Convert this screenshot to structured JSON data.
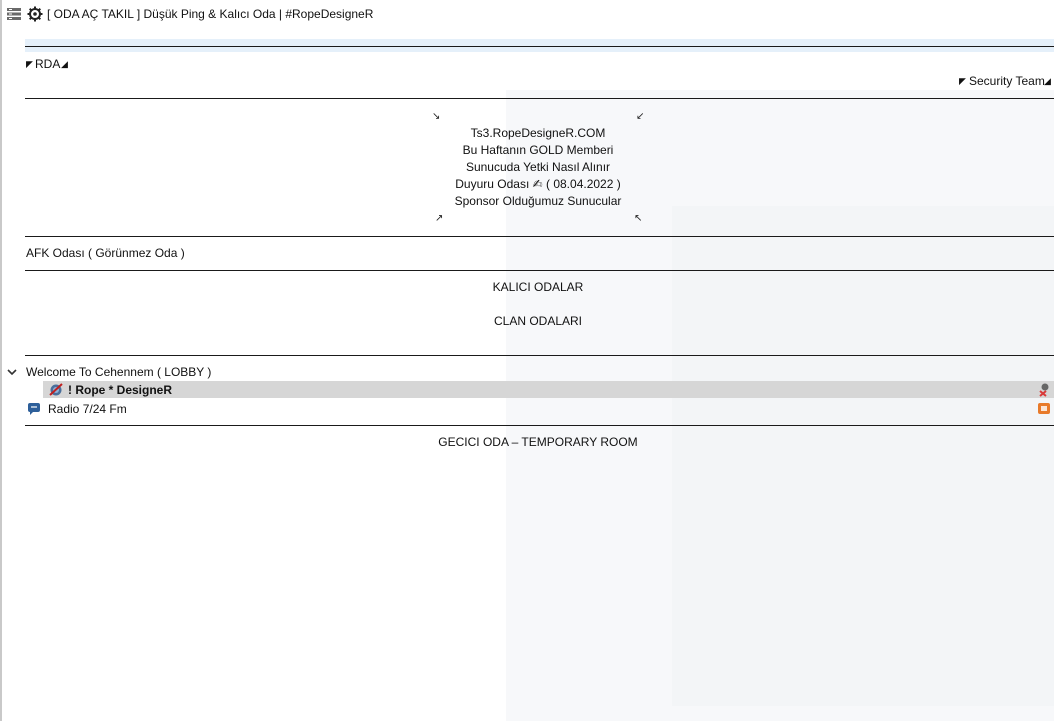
{
  "server": {
    "title": "[ ODA AÇ TAKIL ] Düşük Ping & Kalıcı Oda | #RopeDesigneR"
  },
  "channels": {
    "rda": "RDA",
    "security_team": "Security Team",
    "info_lines": [
      "Ts3.RopeDesigneR.COM",
      "Bu Haftanın GOLD Memberi",
      "Sunucuda Yetki Nasıl Alınır",
      "Duyuru Odası ✍ ( 08.04.2022 )",
      "Sponsor Olduğumuz Sunucular"
    ],
    "afk": "AFK Odası ( Görünmez Oda )",
    "kalici": "KALICI ODALAR",
    "clan": "CLAN ODALARI",
    "lobby": "Welcome To Cehennem ( LOBBY )",
    "temporary": "GECICI ODA – TEMPORARY ROOM"
  },
  "lobby_clients": [
    {
      "name": "!  Rope * DesigneR",
      "selected": true,
      "bold": true
    },
    {
      "name": "Radio 7/24 Fm",
      "selected": false,
      "bold": false
    }
  ],
  "colors": {
    "selection_bg": "#d6d6d6",
    "badge_orange": "#e87a2a",
    "badge_red": "#d93a3a",
    "radio_icon": "#2d5f9a",
    "menu_icon": "#5a5a5a"
  },
  "icons": {
    "menu": "hamburger-menu-icon",
    "server": "server-gear-icon",
    "expand": "chevron-down-icon",
    "muted_client": "microphone-muted-client-icon",
    "radio_client": "speech-bubble-client-icon",
    "away": "away-red-x-icon",
    "badge": "group-badge-icon"
  }
}
